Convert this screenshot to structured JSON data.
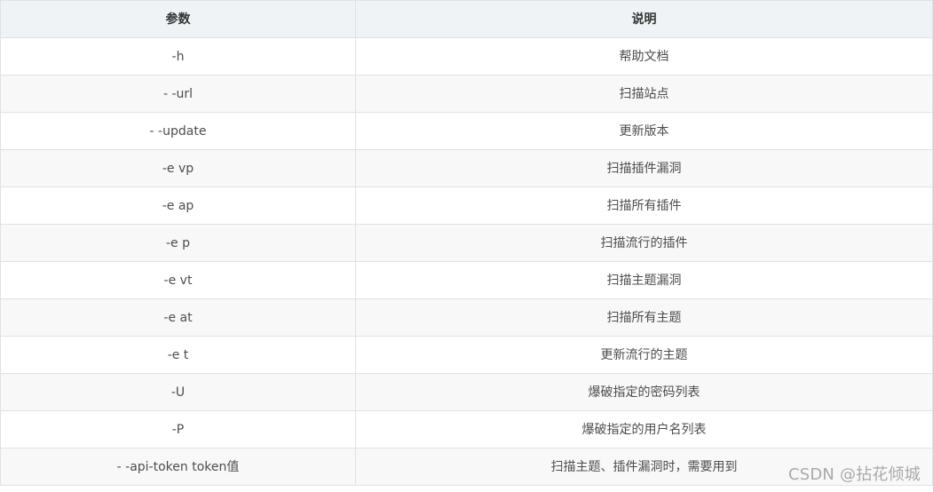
{
  "table": {
    "headers": [
      "参数",
      "说明"
    ],
    "rows": [
      {
        "param": "-h",
        "desc": "帮助文档"
      },
      {
        "param": "- -url",
        "desc": "扫描站点"
      },
      {
        "param": "- -update",
        "desc": "更新版本"
      },
      {
        "param": "-e vp",
        "desc": "扫描插件漏洞"
      },
      {
        "param": "-e ap",
        "desc": "扫描所有插件"
      },
      {
        "param": "-e p",
        "desc": "扫描流行的插件"
      },
      {
        "param": "-e vt",
        "desc": "扫描主题漏洞"
      },
      {
        "param": "-e at",
        "desc": "扫描所有主题"
      },
      {
        "param": "-e t",
        "desc": "更新流行的主题"
      },
      {
        "param": "-U",
        "desc": "爆破指定的密码列表"
      },
      {
        "param": "-P",
        "desc": "爆破指定的用户名列表"
      },
      {
        "param": "- -api-token token值",
        "desc": "扫描主题、插件漏洞时，需要用到"
      }
    ]
  },
  "watermark": "CSDN @拈花倾城",
  "colors": {
    "header_bg": "#eff3f5",
    "alt_row_bg": "#f8f8f8",
    "border": "#dfe2e5",
    "text": "#4d4d4d",
    "watermark": "#a9a9a9"
  }
}
